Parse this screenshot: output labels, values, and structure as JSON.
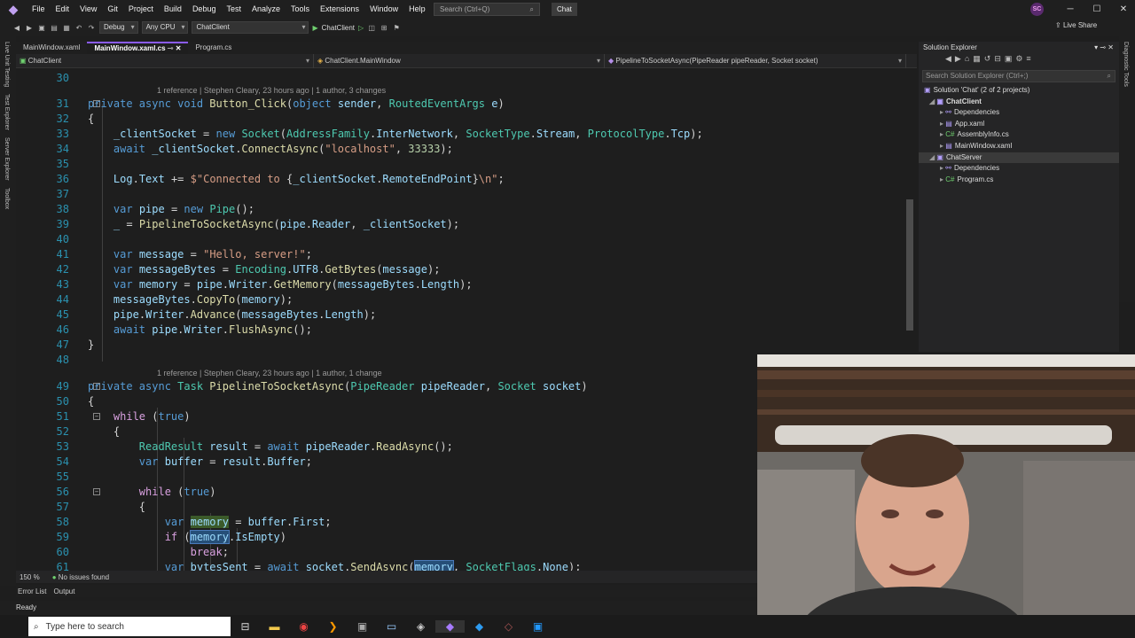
{
  "menubar": {
    "items": [
      "File",
      "Edit",
      "View",
      "Git",
      "Project",
      "Build",
      "Debug",
      "Test",
      "Analyze",
      "Tools",
      "Extensions",
      "Window",
      "Help"
    ],
    "search_placeholder": "Search (Ctrl+Q)",
    "chat_button": "Chat",
    "avatar": "SC"
  },
  "toolbar": {
    "config": "Debug",
    "platform": "Any CPU",
    "startup": "ChatClient",
    "run_label": "ChatClient",
    "live_share": "Live Share"
  },
  "left_strip": [
    "Live Unit Testing",
    "Test Explorer",
    "Server Explorer",
    "Toolbox"
  ],
  "right_strip": [
    "Diagnostic Tools"
  ],
  "doc_tabs": [
    {
      "label": "MainWindow.xaml",
      "active": false
    },
    {
      "label": "MainWindow.xaml.cs",
      "active": true
    },
    {
      "label": "Program.cs",
      "active": false
    }
  ],
  "navbar": {
    "project": "ChatClient",
    "type": "ChatClient.MainWindow",
    "member": "PipelineToSocketAsync(PipeReader pipeReader, Socket socket)"
  },
  "lens": {
    "l31": "1 reference | Stephen Cleary, 23 hours ago | 1 author, 3 changes",
    "l49": "1 reference | Stephen Cleary, 23 hours ago | 1 author, 1 change"
  },
  "status": {
    "zoom": "150 %",
    "issues": "No issues found"
  },
  "bottom_tabs": [
    "Error List",
    "Output"
  ],
  "ready": "Ready",
  "solution_explorer": {
    "title": "Solution Explorer",
    "search": "Search Solution Explorer (Ctrl+;)",
    "nodes": [
      "Solution 'Chat' (2 of 2 projects)",
      "ChatClient",
      "Dependencies",
      "App.xaml",
      "AssemblyInfo.cs",
      "MainWindow.xaml",
      "ChatServer",
      "Dependencies",
      "Program.cs"
    ]
  },
  "taskbar": {
    "search": "Type here to search"
  }
}
